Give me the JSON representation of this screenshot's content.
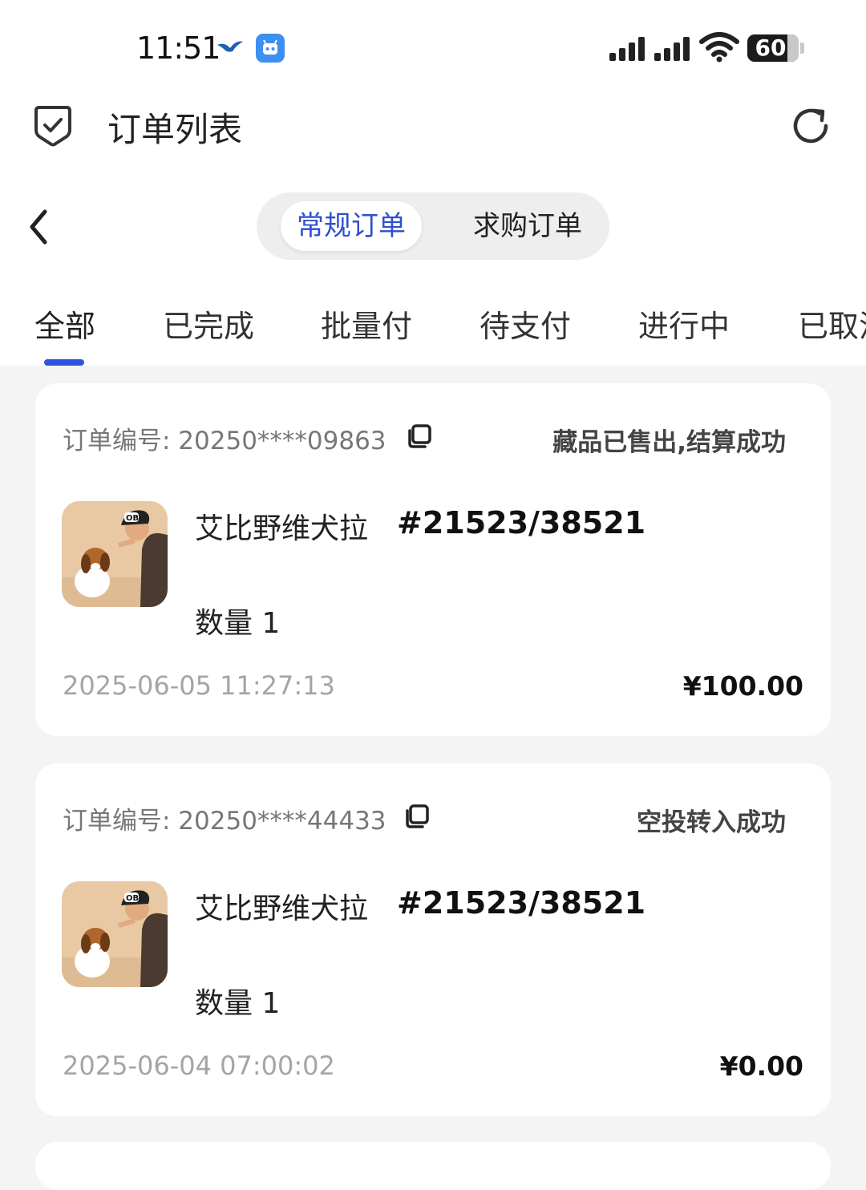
{
  "status_bar": {
    "time": "11:51",
    "battery": "60"
  },
  "header": {
    "title": "订单列表"
  },
  "segment": {
    "active": "常规订单",
    "inactive": "求购订单"
  },
  "tabs": [
    {
      "label": "全部",
      "active": true
    },
    {
      "label": "已完成",
      "active": false
    },
    {
      "label": "批量付",
      "active": false
    },
    {
      "label": "待支付",
      "active": false
    },
    {
      "label": "进行中",
      "active": false
    },
    {
      "label": "已取消",
      "active": false
    }
  ],
  "orders": [
    {
      "order_label": "订单编号: 20250****09863",
      "status": "藏品已售出,结算成功",
      "name": "艾比野维犬拉",
      "number": "#21523/38521",
      "qty": "数量 1",
      "time": "2025-06-05 11:27:13",
      "price": "¥100.00"
    },
    {
      "order_label": "订单编号: 20250****44433",
      "status": "空投转入成功",
      "name": "艾比野维犬拉",
      "number": "#21523/38521",
      "qty": "数量 1",
      "time": "2025-06-04 07:00:02",
      "price": "¥0.00"
    }
  ],
  "colors": {
    "accent": "#2f55e0",
    "background": "#f4f4f4"
  }
}
